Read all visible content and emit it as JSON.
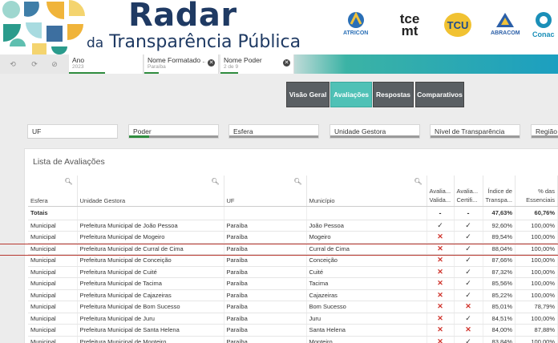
{
  "header": {
    "title": "Radar",
    "subtitle_da": "da",
    "subtitle_rest": "Transparência Pública",
    "logos": [
      {
        "name": "atricon",
        "caption": "ATRICON",
        "color": "#2a6fb6"
      },
      {
        "name": "tce-mt",
        "caption": "tce mt",
        "color": "#222222"
      },
      {
        "name": "tcu",
        "caption": "TCU",
        "color": "#1d4a8c"
      },
      {
        "name": "abracom",
        "caption": "ABRACOM",
        "color": "#2b5fa8"
      },
      {
        "name": "conaci",
        "caption": "Conac",
        "color": "#1a8fb8"
      }
    ]
  },
  "filterbar": {
    "chips": [
      {
        "label": "Ano",
        "value": "2023"
      },
      {
        "label": "Nome Formatado ...",
        "value": "Paraíba"
      },
      {
        "label": "Nome Poder",
        "value": "2 de 9"
      }
    ]
  },
  "tabs": [
    {
      "label": "Visão Geral",
      "active": false
    },
    {
      "label": "Avaliações",
      "active": true
    },
    {
      "label": "Respostas",
      "active": false
    },
    {
      "label": "Comparativos",
      "active": false
    }
  ],
  "filters": [
    "UF",
    "Poder",
    "Esfera",
    "Unidade Gestora",
    "Nível de Transparência",
    "Região"
  ],
  "panel": {
    "title": "Lista de Avaliações",
    "columns": [
      "Esfera",
      "Unidade Gestora",
      "UF",
      "Município",
      "Avalia... Valida...",
      "Avalia... Certifi...",
      "Índice de Transpa...",
      "% das Essenciais"
    ],
    "totals": {
      "label": "Totais",
      "v1": "-",
      "v2": "-",
      "indice": "47,63%",
      "essenciais": "60,76%"
    },
    "rows": [
      {
        "esfera": "Municipal",
        "unidade": "Prefeitura Municipal de João Pessoa",
        "uf": "Paraíba",
        "municipio": "João Pessoa",
        "validada": true,
        "certificada": true,
        "indice": "92,60%",
        "essenciais": "100,00%"
      },
      {
        "esfera": "Municipal",
        "unidade": "Prefeitura Municipal de Mogeiro",
        "uf": "Paraíba",
        "municipio": "Mogeiro",
        "validada": false,
        "certificada": true,
        "indice": "89,54%",
        "essenciais": "100,00%"
      },
      {
        "esfera": "Municipal",
        "unidade": "Prefeitura Municipal de Curral de Cima",
        "uf": "Paraíba",
        "municipio": "Curral de Cima",
        "validada": false,
        "certificada": true,
        "indice": "88,04%",
        "essenciais": "100,00%"
      },
      {
        "esfera": "Municipal",
        "unidade": "Prefeitura Municipal de Conceição",
        "uf": "Paraíba",
        "municipio": "Conceição",
        "validada": false,
        "certificada": true,
        "indice": "87,66%",
        "essenciais": "100,00%"
      },
      {
        "esfera": "Municipal",
        "unidade": "Prefeitura Municipal de Cuité",
        "uf": "Paraíba",
        "municipio": "Cuité",
        "validada": false,
        "certificada": true,
        "indice": "87,32%",
        "essenciais": "100,00%"
      },
      {
        "esfera": "Municipal",
        "unidade": "Prefeitura Municipal de Tacima",
        "uf": "Paraíba",
        "municipio": "Tacima",
        "validada": false,
        "certificada": true,
        "indice": "85,56%",
        "essenciais": "100,00%"
      },
      {
        "esfera": "Municipal",
        "unidade": "Prefeitura Municipal de Cajazeiras",
        "uf": "Paraíba",
        "municipio": "Cajazeiras",
        "validada": false,
        "certificada": true,
        "indice": "85,22%",
        "essenciais": "100,00%"
      },
      {
        "esfera": "Municipal",
        "unidade": "Prefeitura Municipal de Bom Sucesso",
        "uf": "Paraíba",
        "municipio": "Bom Sucesso",
        "validada": false,
        "certificada": false,
        "indice": "85,01%",
        "essenciais": "78,79%"
      },
      {
        "esfera": "Municipal",
        "unidade": "Prefeitura Municipal de Juru",
        "uf": "Paraíba",
        "municipio": "Juru",
        "validada": false,
        "certificada": true,
        "indice": "84,51%",
        "essenciais": "100,00%"
      },
      {
        "esfera": "Municipal",
        "unidade": "Prefeitura Municipal de Santa Helena",
        "uf": "Paraíba",
        "municipio": "Santa Helena",
        "validada": false,
        "certificada": false,
        "indice": "84,00%",
        "essenciais": "87,88%"
      },
      {
        "esfera": "Municipal",
        "unidade": "Prefeitura Municipal de Monteiro",
        "uf": "Paraíba",
        "municipio": "Monteiro",
        "validada": false,
        "certificada": true,
        "indice": "83,84%",
        "essenciais": "100,00%"
      }
    ]
  },
  "colors": {
    "accent": "#4fc1b6",
    "tab": "#5a5f63",
    "error": "#d0342c",
    "brand": "#1f3a63"
  }
}
